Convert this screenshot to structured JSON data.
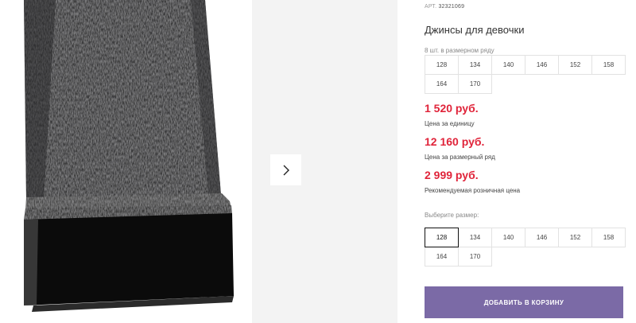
{
  "product": {
    "article_label": "АРТ.",
    "article_number": "32321069",
    "title": "Джинсы для девочки"
  },
  "size_row": {
    "label": "8 шт. в размерном ряду",
    "sizes": [
      "128",
      "134",
      "140",
      "146",
      "152",
      "158",
      "164",
      "170"
    ]
  },
  "prices": [
    {
      "amount": "1 520 руб.",
      "note": "Цена за единицу"
    },
    {
      "amount": "12 160 руб.",
      "note": "Цена за размерный ряд"
    },
    {
      "amount": "2 999 руб.",
      "note": "Рекомендуемая розничная цена"
    }
  ],
  "size_select": {
    "label": "Выберите размер:",
    "sizes": [
      "128",
      "134",
      "140",
      "146",
      "152",
      "158",
      "164",
      "170"
    ],
    "selected": "128"
  },
  "cart_button": "ДОБАВИТЬ В КОРЗИНУ",
  "gallery": {
    "next_icon": "chevron-right-icon"
  },
  "colors": {
    "price": "#e0243a",
    "button": "#7b6aa6",
    "gallery_bg": "#f3f3f3"
  }
}
